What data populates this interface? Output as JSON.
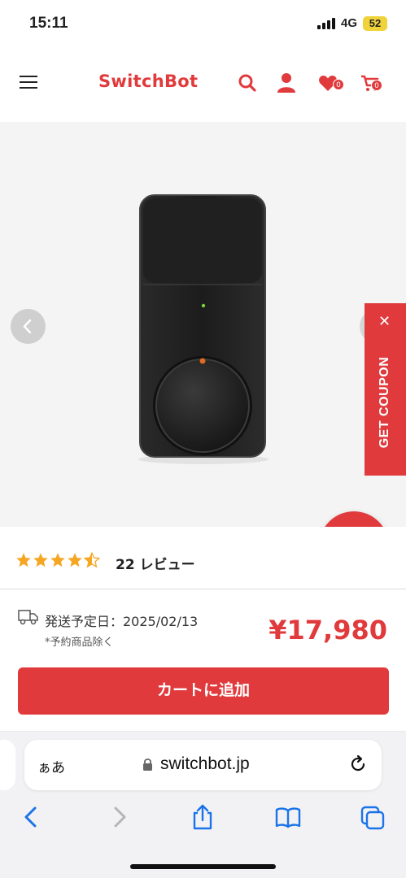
{
  "status_bar": {
    "time": "15:11",
    "network": "4G",
    "battery": "52"
  },
  "header": {
    "logo": "SwitchBot",
    "wishlist_count": "0",
    "cart_count": "0"
  },
  "product": {
    "image": "switchbot-lock-pro-black",
    "coupon_tab": {
      "label": "GET COUPON",
      "close": "✕"
    }
  },
  "reviews": {
    "rating": 4.5,
    "count_label": "22 レビュー"
  },
  "shipping": {
    "date_label": "発送予定日：2025/02/13",
    "note": "*予約商品除く"
  },
  "price": "¥17,980",
  "cart_button": "カートに追加",
  "browser": {
    "aa_label": "ぁあ",
    "url": "switchbot.jp",
    "toolbar": [
      "back-icon",
      "forward-icon",
      "share-icon",
      "bookmarks-icon",
      "tabs-icon"
    ]
  },
  "colors": {
    "brand": "#e03a3c",
    "star": "#f5a623"
  }
}
